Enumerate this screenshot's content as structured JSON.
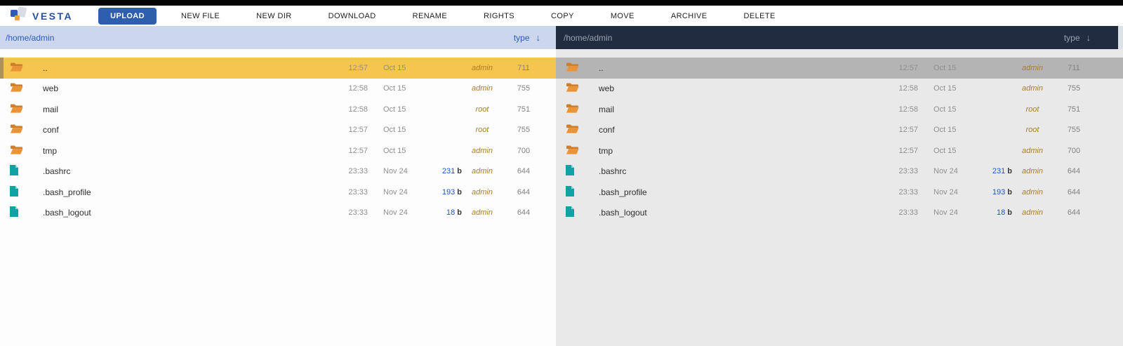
{
  "topbar": {
    "logo_text": "VESTA",
    "buttons": [
      {
        "label": "UPLOAD",
        "primary": true
      },
      {
        "label": "NEW FILE",
        "primary": false
      },
      {
        "label": "NEW DIR",
        "primary": false
      },
      {
        "label": "DOWNLOAD",
        "primary": false
      },
      {
        "label": "RENAME",
        "primary": false
      },
      {
        "label": "RIGHTS",
        "primary": false
      },
      {
        "label": "COPY",
        "primary": false
      },
      {
        "label": "MOVE",
        "primary": false
      },
      {
        "label": "ARCHIVE",
        "primary": false
      },
      {
        "label": "DELETE",
        "primary": false
      }
    ]
  },
  "colors": {
    "accent_blue": "#2e5fae",
    "left_header_bg": "#ccd6ed",
    "right_header_bg": "#222c40",
    "selected_yellow": "#f6c54d",
    "selected_gray": "#b4b4b4",
    "folder_orange": "#e5892f",
    "file_teal": "#12a1a5",
    "size_blue": "#1d56c8",
    "owner_tan": "#ab7d2c"
  },
  "panes": [
    {
      "side": "left",
      "path": "/home/admin",
      "sort": {
        "label": "type",
        "arrow": "↓"
      },
      "rows": [
        {
          "type": "folder",
          "name": "..",
          "time": "12:57",
          "date": "Oct 15",
          "size_num": "",
          "size_unit": "",
          "owner": "admin",
          "perms": "711",
          "selected": true
        },
        {
          "type": "folder",
          "name": "web",
          "time": "12:58",
          "date": "Oct 15",
          "size_num": "",
          "size_unit": "",
          "owner": "admin",
          "perms": "755",
          "selected": false
        },
        {
          "type": "folder",
          "name": "mail",
          "time": "12:58",
          "date": "Oct 15",
          "size_num": "",
          "size_unit": "",
          "owner": "root",
          "perms": "751",
          "selected": false
        },
        {
          "type": "folder",
          "name": "conf",
          "time": "12:57",
          "date": "Oct 15",
          "size_num": "",
          "size_unit": "",
          "owner": "root",
          "perms": "755",
          "selected": false
        },
        {
          "type": "folder",
          "name": "tmp",
          "time": "12:57",
          "date": "Oct 15",
          "size_num": "",
          "size_unit": "",
          "owner": "admin",
          "perms": "700",
          "selected": false
        },
        {
          "type": "file",
          "name": ".bashrc",
          "time": "23:33",
          "date": "Nov 24",
          "size_num": "231",
          "size_unit": "b",
          "owner": "admin",
          "perms": "644",
          "selected": false
        },
        {
          "type": "file",
          "name": ".bash_profile",
          "time": "23:33",
          "date": "Nov 24",
          "size_num": "193",
          "size_unit": "b",
          "owner": "admin",
          "perms": "644",
          "selected": false
        },
        {
          "type": "file",
          "name": ".bash_logout",
          "time": "23:33",
          "date": "Nov 24",
          "size_num": "18",
          "size_unit": "b",
          "owner": "admin",
          "perms": "644",
          "selected": false
        }
      ]
    },
    {
      "side": "right",
      "path": "/home/admin",
      "sort": {
        "label": "type",
        "arrow": "↓"
      },
      "rows": [
        {
          "type": "folder",
          "name": "..",
          "time": "12:57",
          "date": "Oct 15",
          "size_num": "",
          "size_unit": "",
          "owner": "admin",
          "perms": "711",
          "selected": true
        },
        {
          "type": "folder",
          "name": "web",
          "time": "12:58",
          "date": "Oct 15",
          "size_num": "",
          "size_unit": "",
          "owner": "admin",
          "perms": "755",
          "selected": false
        },
        {
          "type": "folder",
          "name": "mail",
          "time": "12:58",
          "date": "Oct 15",
          "size_num": "",
          "size_unit": "",
          "owner": "root",
          "perms": "751",
          "selected": false
        },
        {
          "type": "folder",
          "name": "conf",
          "time": "12:57",
          "date": "Oct 15",
          "size_num": "",
          "size_unit": "",
          "owner": "root",
          "perms": "755",
          "selected": false
        },
        {
          "type": "folder",
          "name": "tmp",
          "time": "12:57",
          "date": "Oct 15",
          "size_num": "",
          "size_unit": "",
          "owner": "admin",
          "perms": "700",
          "selected": false
        },
        {
          "type": "file",
          "name": ".bashrc",
          "time": "23:33",
          "date": "Nov 24",
          "size_num": "231",
          "size_unit": "b",
          "owner": "admin",
          "perms": "644",
          "selected": false
        },
        {
          "type": "file",
          "name": ".bash_profile",
          "time": "23:33",
          "date": "Nov 24",
          "size_num": "193",
          "size_unit": "b",
          "owner": "admin",
          "perms": "644",
          "selected": false
        },
        {
          "type": "file",
          "name": ".bash_logout",
          "time": "23:33",
          "date": "Nov 24",
          "size_num": "18",
          "size_unit": "b",
          "owner": "admin",
          "perms": "644",
          "selected": false
        }
      ]
    }
  ]
}
